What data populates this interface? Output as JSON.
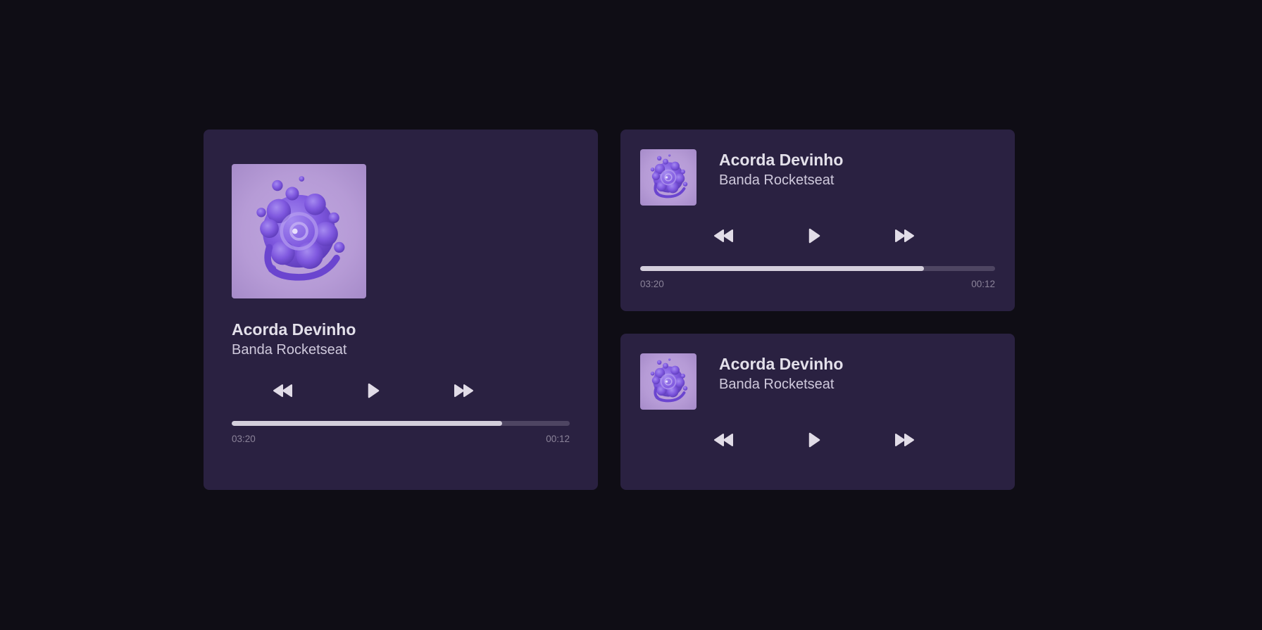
{
  "players": [
    {
      "title": "Acorda Devinho",
      "artist": "Banda Rocketseat",
      "elapsed": "03:20",
      "total": "00:12",
      "progress": 0.8
    },
    {
      "title": "Acorda Devinho",
      "artist": "Banda Rocketseat",
      "elapsed": "03:20",
      "total": "00:12",
      "progress": 0.8
    },
    {
      "title": "Acorda Devinho",
      "artist": "Banda Rocketseat"
    }
  ],
  "icons": {
    "cover": "album-art-icon",
    "previous": "rewind-icon",
    "play": "play-icon",
    "next": "fast-forward-icon"
  },
  "colors": {
    "background": "#0f0d15",
    "card": "#2a2141",
    "progress_fill": "#d4cfdc",
    "progress_track": "#4e4562",
    "cover_bg": "#b69bd6",
    "cover_art": "#7f58df"
  }
}
